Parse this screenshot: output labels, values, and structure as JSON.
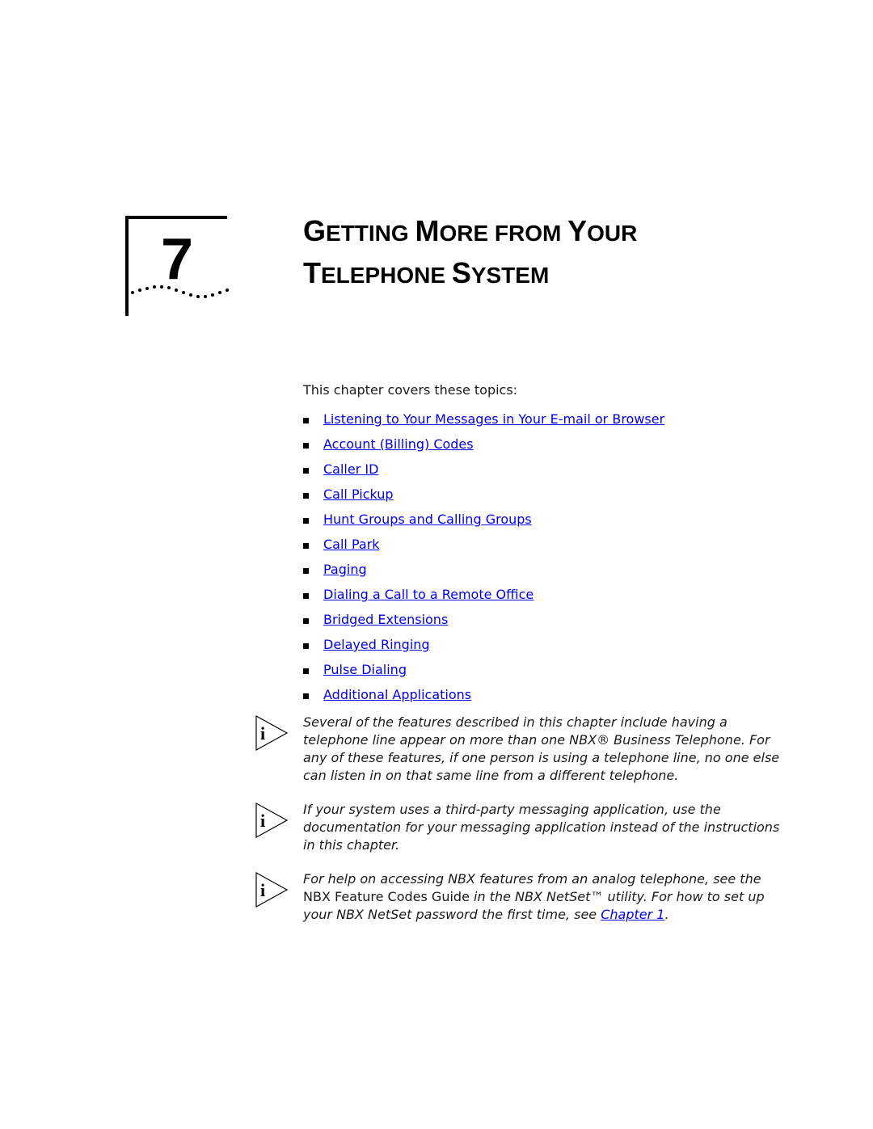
{
  "chapter": {
    "number": "7",
    "title_line1": [
      {
        "big": "G",
        "small": "ETTING "
      },
      {
        "big": "M",
        "small": "ORE FROM "
      },
      {
        "big": "Y",
        "small": "OUR"
      }
    ],
    "title_line2": [
      {
        "big": "T",
        "small": "ELEPHONE "
      },
      {
        "big": "S",
        "small": "YSTEM"
      }
    ]
  },
  "intro": "This chapter covers these topics:",
  "topics": [
    "Listening to Your Messages in Your E-mail or Browser",
    "Account (Billing) Codes",
    "Caller ID",
    "Call Pickup",
    "Hunt Groups and Calling Groups",
    "Call Park",
    "Paging",
    "Dialing a Call to a Remote Office",
    "Bridged Extensions",
    "Delayed Ringing",
    "Pulse Dialing",
    "Additional Applications"
  ],
  "notes": {
    "note1": "Several of the features described in this chapter include having a telephone line appear on more than one NBX® Business Telephone. For any of these features, if one person is using a telephone line, no one else can listen in on that same line from a different telephone.",
    "note2": "If your system uses a third-party messaging application, use the documentation for your messaging application instead of the instructions in this chapter.",
    "note3": {
      "part1": "For help on accessing NBX features from an analog telephone, see the ",
      "upright": "NBX Feature Codes Guide",
      "part2": " in the NBX NetSet™ utility. For how to set up your NBX NetSet password the first time, see ",
      "link": "Chapter 1",
      "part3": "."
    }
  },
  "icons": {
    "note_icon": "info-icon"
  }
}
